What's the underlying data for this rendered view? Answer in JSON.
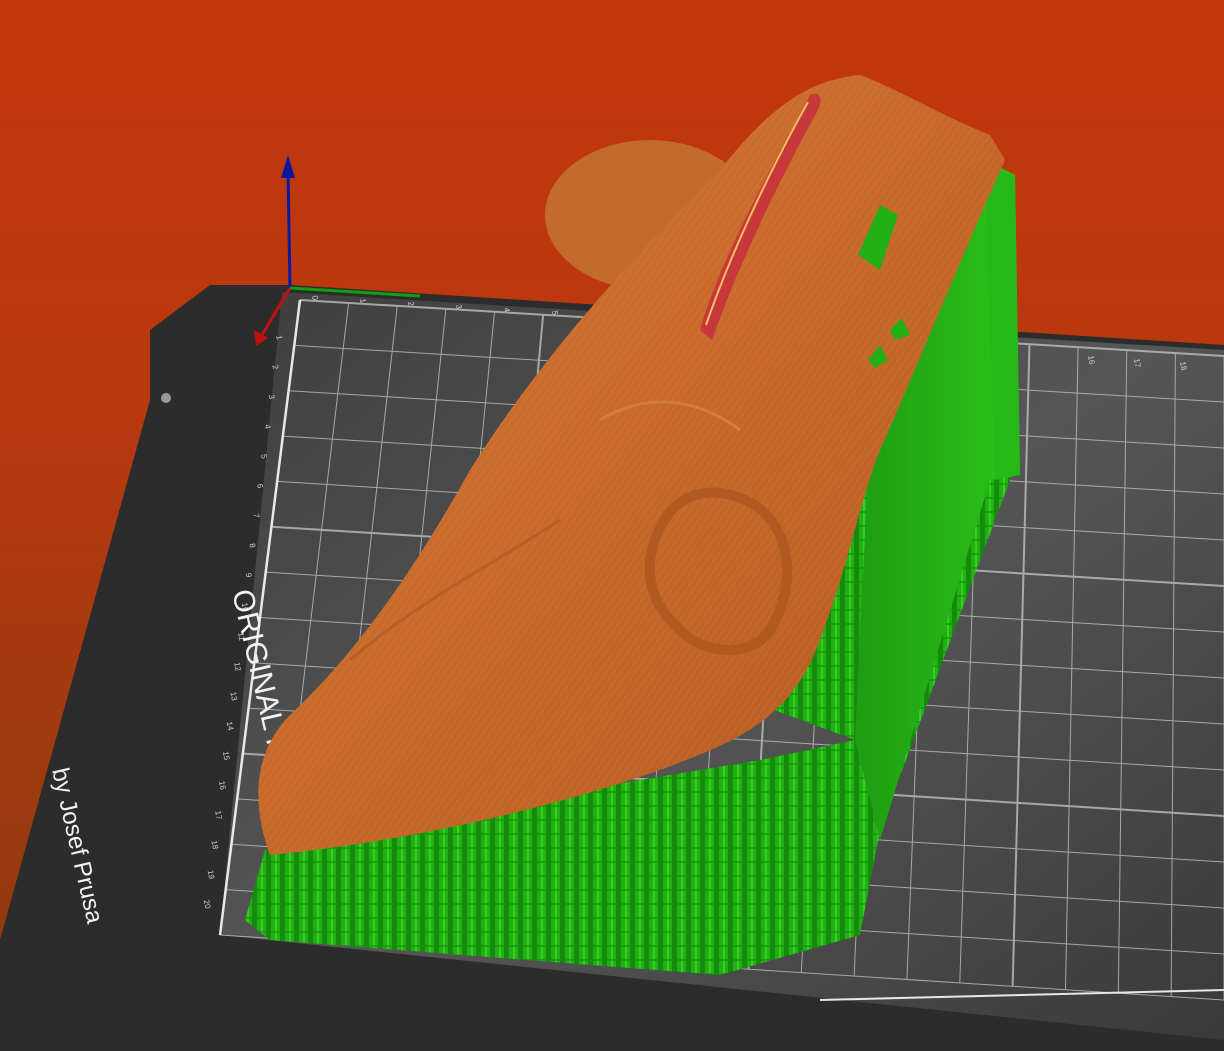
{
  "scene": {
    "background_top": "#c4360c",
    "background_bottom": "#8a3810",
    "bed_color": "#3a3a3a",
    "grid_color": "#c8c8c8",
    "model_color": "#c86a2c",
    "support_color": "#22b014",
    "axis_x_color": "#c01010",
    "axis_y_color": "#10a010",
    "axis_z_color": "#0a1aa0"
  },
  "bed": {
    "label_line1": "ORIGINAL PRUSA i3  MK3",
    "label_line2": "by Josef Prusa",
    "top_ticks": [
      "0",
      "1",
      "2",
      "3",
      "4",
      "5"
    ],
    "left_ticks": [
      "1",
      "2",
      "3",
      "4",
      "5",
      "6",
      "7",
      "8",
      "9",
      "10",
      "11",
      "12",
      "13",
      "14",
      "15",
      "16",
      "17",
      "18",
      "19",
      "20"
    ],
    "right_ticks": [
      "16",
      "17",
      "18"
    ]
  }
}
